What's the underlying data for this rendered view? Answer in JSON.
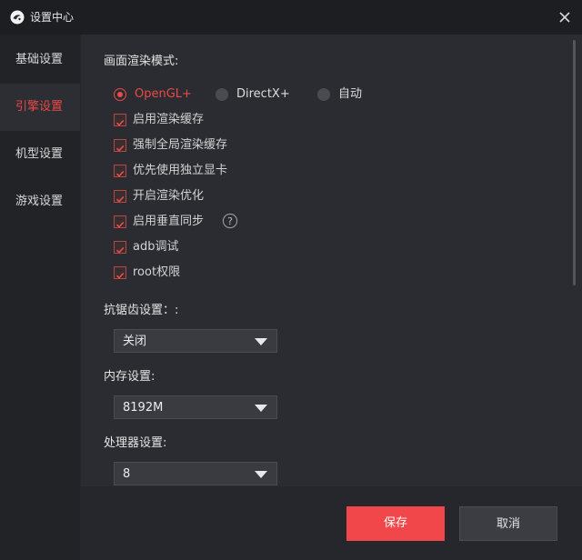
{
  "window": {
    "title": "设置中心",
    "logo_icon": "app-logo-icon",
    "close_icon": "close-icon"
  },
  "sidebar": {
    "items": [
      {
        "label": "基础设置",
        "active": false
      },
      {
        "label": "引擎设置",
        "active": true
      },
      {
        "label": "机型设置",
        "active": false
      },
      {
        "label": "游戏设置",
        "active": false
      }
    ]
  },
  "render_mode": {
    "title": "画面渲染模式:",
    "options": [
      {
        "label": "OpenGL+",
        "selected": true
      },
      {
        "label": "DirectX+",
        "selected": false
      },
      {
        "label": "自动",
        "selected": false
      }
    ]
  },
  "checkboxes": [
    {
      "label": "启用渲染缓存",
      "checked": true
    },
    {
      "label": "强制全局渲染缓存",
      "checked": true
    },
    {
      "label": "优先使用独立显卡",
      "checked": true
    },
    {
      "label": "开启渲染优化",
      "checked": true
    },
    {
      "label": "启用垂直同步",
      "checked": true,
      "help_icon": "help-icon"
    },
    {
      "label": "adb调试",
      "checked": true
    },
    {
      "label": "root权限",
      "checked": true
    }
  ],
  "antialias": {
    "title": "抗锯齿设置：:",
    "value": "关闭"
  },
  "memory": {
    "title": "内存设置:",
    "value": "8192M"
  },
  "cpu": {
    "title": "处理器设置:",
    "value": "8"
  },
  "footer": {
    "save_label": "保存",
    "cancel_label": "取消"
  },
  "colors": {
    "accent": "#e84a46",
    "save_button": "#f2474a",
    "background": "#2b2c31",
    "sidebar": "#222327"
  }
}
